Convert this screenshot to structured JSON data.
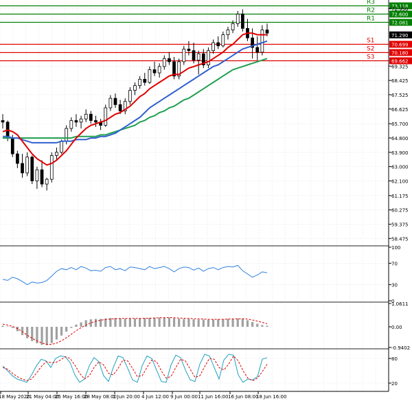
{
  "chart_data": {
    "type": "candlestick",
    "grid": true,
    "main": {
      "y_ticks": [
        58.475,
        59.375,
        60.275,
        61.175,
        62.1,
        63.0,
        63.9,
        64.8,
        65.7,
        66.625,
        67.525,
        68.425,
        69.325,
        72.95
      ],
      "y_range": [
        58.1,
        73.4
      ],
      "candles": [
        {
          "o": 65.9,
          "h": 66.3,
          "l": 65.4,
          "c": 65.8
        },
        {
          "o": 65.8,
          "h": 65.9,
          "l": 64.6,
          "c": 64.8
        },
        {
          "o": 64.8,
          "h": 65.0,
          "l": 63.6,
          "c": 63.8
        },
        {
          "o": 63.8,
          "h": 64.0,
          "l": 62.9,
          "c": 63.2
        },
        {
          "o": 63.2,
          "h": 63.8,
          "l": 62.3,
          "c": 62.6
        },
        {
          "o": 62.6,
          "h": 63.9,
          "l": 62.4,
          "c": 63.6
        },
        {
          "o": 63.6,
          "h": 63.7,
          "l": 61.9,
          "c": 62.1
        },
        {
          "o": 62.1,
          "h": 63.0,
          "l": 61.6,
          "c": 62.8
        },
        {
          "o": 62.8,
          "h": 63.4,
          "l": 61.7,
          "c": 61.9
        },
        {
          "o": 61.9,
          "h": 62.3,
          "l": 61.5,
          "c": 62.2
        },
        {
          "o": 62.2,
          "h": 63.9,
          "l": 62.0,
          "c": 63.7
        },
        {
          "o": 63.7,
          "h": 64.2,
          "l": 63.4,
          "c": 63.9
        },
        {
          "o": 63.9,
          "h": 64.7,
          "l": 63.8,
          "c": 64.6
        },
        {
          "o": 64.6,
          "h": 65.6,
          "l": 64.4,
          "c": 65.4
        },
        {
          "o": 65.4,
          "h": 66.1,
          "l": 65.2,
          "c": 65.9
        },
        {
          "o": 65.9,
          "h": 66.3,
          "l": 65.5,
          "c": 65.8
        },
        {
          "o": 65.8,
          "h": 66.2,
          "l": 65.4,
          "c": 66.0
        },
        {
          "o": 66.0,
          "h": 66.6,
          "l": 65.8,
          "c": 66.3
        },
        {
          "o": 66.3,
          "h": 66.5,
          "l": 65.7,
          "c": 65.9
        },
        {
          "o": 65.9,
          "h": 66.2,
          "l": 65.5,
          "c": 65.8
        },
        {
          "o": 65.8,
          "h": 66.0,
          "l": 65.3,
          "c": 65.6
        },
        {
          "o": 65.6,
          "h": 66.9,
          "l": 65.5,
          "c": 66.7
        },
        {
          "o": 66.7,
          "h": 67.5,
          "l": 66.5,
          "c": 67.3
        },
        {
          "o": 67.3,
          "h": 67.6,
          "l": 66.7,
          "c": 66.9
        },
        {
          "o": 66.9,
          "h": 67.2,
          "l": 66.3,
          "c": 66.5
        },
        {
          "o": 66.5,
          "h": 67.3,
          "l": 66.3,
          "c": 67.1
        },
        {
          "o": 67.1,
          "h": 68.0,
          "l": 66.9,
          "c": 67.8
        },
        {
          "o": 67.8,
          "h": 68.3,
          "l": 67.5,
          "c": 68.1
        },
        {
          "o": 68.1,
          "h": 68.7,
          "l": 67.9,
          "c": 68.5
        },
        {
          "o": 68.5,
          "h": 68.9,
          "l": 68.1,
          "c": 68.3
        },
        {
          "o": 68.3,
          "h": 69.3,
          "l": 68.2,
          "c": 69.1
        },
        {
          "o": 69.1,
          "h": 69.6,
          "l": 68.7,
          "c": 68.9
        },
        {
          "o": 68.9,
          "h": 69.5,
          "l": 68.6,
          "c": 69.3
        },
        {
          "o": 69.3,
          "h": 70.0,
          "l": 69.1,
          "c": 69.8
        },
        {
          "o": 69.8,
          "h": 70.2,
          "l": 69.4,
          "c": 69.6
        },
        {
          "o": 69.6,
          "h": 69.9,
          "l": 68.5,
          "c": 68.7
        },
        {
          "o": 68.7,
          "h": 69.8,
          "l": 68.5,
          "c": 69.6
        },
        {
          "o": 69.6,
          "h": 70.6,
          "l": 69.4,
          "c": 70.4
        },
        {
          "o": 70.4,
          "h": 70.9,
          "l": 70.0,
          "c": 70.3
        },
        {
          "o": 70.3,
          "h": 70.8,
          "l": 69.5,
          "c": 69.7
        },
        {
          "o": 69.7,
          "h": 70.3,
          "l": 68.8,
          "c": 70.1
        },
        {
          "o": 70.1,
          "h": 70.4,
          "l": 69.2,
          "c": 69.4
        },
        {
          "o": 69.4,
          "h": 70.5,
          "l": 69.2,
          "c": 70.3
        },
        {
          "o": 70.3,
          "h": 71.0,
          "l": 70.1,
          "c": 70.8
        },
        {
          "o": 70.8,
          "h": 71.2,
          "l": 70.4,
          "c": 70.6
        },
        {
          "o": 70.6,
          "h": 71.5,
          "l": 70.5,
          "c": 71.3
        },
        {
          "o": 71.3,
          "h": 71.8,
          "l": 71.0,
          "c": 71.6
        },
        {
          "o": 71.6,
          "h": 72.2,
          "l": 71.4,
          "c": 72.0
        },
        {
          "o": 72.0,
          "h": 72.8,
          "l": 71.8,
          "c": 72.6
        },
        {
          "o": 72.6,
          "h": 72.9,
          "l": 71.5,
          "c": 71.7
        },
        {
          "o": 71.7,
          "h": 72.3,
          "l": 70.9,
          "c": 71.1
        },
        {
          "o": 71.1,
          "h": 71.7,
          "l": 69.8,
          "c": 70.5
        },
        {
          "o": 70.5,
          "h": 71.2,
          "l": 69.7,
          "c": 70.2
        },
        {
          "o": 70.2,
          "h": 71.9,
          "l": 70.0,
          "c": 71.6
        },
        {
          "o": 71.6,
          "h": 72.0,
          "l": 71.2,
          "c": 71.4
        }
      ],
      "sma_red": [
        65.2,
        65.3,
        65.2,
        65.0,
        64.6,
        64.2,
        63.8,
        63.5,
        63.3,
        63.1,
        63.2,
        63.4,
        63.7,
        64.0,
        64.4,
        64.8,
        65.1,
        65.4,
        65.6,
        65.7,
        65.8,
        65.9,
        66.1,
        66.3,
        66.4,
        66.6,
        66.8,
        67.1,
        67.4,
        67.6,
        67.9,
        68.1,
        68.3,
        68.5,
        68.7,
        68.8,
        68.8,
        69.0,
        69.2,
        69.3,
        69.4,
        69.5,
        69.6,
        69.8,
        70.0,
        70.2,
        70.5,
        70.7,
        71.0,
        71.3,
        71.4,
        71.4,
        71.3,
        71.3,
        71.3
      ],
      "sma_blue": [
        64.9,
        64.9,
        64.8,
        64.8,
        64.7,
        64.6,
        64.5,
        64.5,
        64.5,
        64.5,
        64.5,
        64.5,
        64.6,
        64.6,
        64.6,
        64.7,
        64.7,
        64.7,
        64.8,
        64.8,
        64.9,
        64.9,
        65.0,
        65.1,
        65.3,
        65.5,
        65.7,
        65.9,
        66.1,
        66.4,
        66.7,
        66.9,
        67.1,
        67.3,
        67.5,
        67.7,
        67.9,
        68.1,
        68.3,
        68.5,
        68.7,
        68.9,
        69.1,
        69.3,
        69.4,
        69.6,
        69.8,
        70.0,
        70.2,
        70.4,
        70.5,
        70.6,
        70.7,
        70.8,
        70.9
      ],
      "sma_green": [
        64.8,
        64.8,
        64.8,
        64.8,
        64.8,
        64.8,
        64.8,
        64.8,
        64.8,
        64.8,
        64.8,
        64.8,
        64.8,
        64.8,
        64.8,
        64.9,
        64.9,
        64.9,
        64.9,
        64.9,
        65.0,
        65.0,
        65.1,
        65.2,
        65.3,
        65.4,
        65.5,
        65.6,
        65.8,
        65.9,
        66.1,
        66.2,
        66.4,
        66.5,
        66.7,
        66.8,
        67.0,
        67.2,
        67.3,
        67.5,
        67.7,
        67.9,
        68.1,
        68.3,
        68.5,
        68.7,
        68.9,
        69.1,
        69.2,
        69.3,
        69.4,
        69.5,
        69.6,
        69.7,
        69.8
      ],
      "levels": [
        {
          "name": "R3",
          "value": 73.118,
          "label": "73.118",
          "color": "#008000",
          "badge": "#008000"
        },
        {
          "name": "R2",
          "value": 72.6,
          "label": "72.600",
          "color": "#008000",
          "badge": "#008000"
        },
        {
          "name": "R1",
          "value": 72.081,
          "label": "72.081",
          "color": "#008000",
          "badge": "#008000"
        },
        {
          "name": "",
          "value": 71.29,
          "label": "71.290",
          "color": "none",
          "badge": "#000000"
        },
        {
          "name": "S1",
          "value": 70.699,
          "label": "70.699",
          "color": "#e00000",
          "badge": "#e00000"
        },
        {
          "name": "S2",
          "value": 70.18,
          "label": "70.180",
          "color": "#e00000",
          "badge": "#e00000"
        },
        {
          "name": "S3",
          "value": 69.662,
          "label": "69.662",
          "color": "#e00000",
          "badge": "#e00000"
        }
      ]
    },
    "rsi": {
      "y_ticks": [
        100,
        70,
        30,
        0
      ],
      "values": [
        40,
        38,
        44,
        41,
        36,
        30,
        35,
        33,
        34,
        38,
        46,
        55,
        60,
        58,
        62,
        58,
        64,
        61,
        56,
        57,
        55,
        62,
        64,
        58,
        60,
        56,
        63,
        62,
        60,
        58,
        64,
        60,
        62,
        64,
        60,
        54,
        60,
        63,
        62,
        57,
        61,
        55,
        60,
        62,
        58,
        62,
        64,
        63,
        66,
        56,
        50,
        44,
        48,
        54,
        52
      ]
    },
    "macd": {
      "y_ticks": [
        "1.0611",
        "0.00",
        "-0.9402"
      ],
      "hist": [
        0.05,
        0.02,
        -0.05,
        -0.2,
        -0.38,
        -0.52,
        -0.65,
        -0.75,
        -0.82,
        -0.84,
        -0.74,
        -0.58,
        -0.4,
        -0.22,
        -0.05,
        0.1,
        0.2,
        0.3,
        0.34,
        0.36,
        0.36,
        0.38,
        0.4,
        0.4,
        0.38,
        0.37,
        0.38,
        0.38,
        0.39,
        0.4,
        0.41,
        0.42,
        0.42,
        0.43,
        0.42,
        0.4,
        0.37,
        0.36,
        0.36,
        0.34,
        0.33,
        0.33,
        0.32,
        0.33,
        0.34,
        0.35,
        0.36,
        0.37,
        0.38,
        0.36,
        0.3,
        0.22,
        0.14,
        0.08,
        0.05
      ],
      "signal": [
        0.12,
        0.08,
        0.02,
        -0.08,
        -0.22,
        -0.38,
        -0.52,
        -0.64,
        -0.74,
        -0.8,
        -0.8,
        -0.74,
        -0.64,
        -0.5,
        -0.34,
        -0.18,
        -0.04,
        0.08,
        0.18,
        0.25,
        0.3,
        0.33,
        0.35,
        0.37,
        0.38,
        0.38,
        0.38,
        0.38,
        0.38,
        0.39,
        0.39,
        0.4,
        0.41,
        0.41,
        0.42,
        0.41,
        0.4,
        0.39,
        0.38,
        0.37,
        0.36,
        0.35,
        0.34,
        0.34,
        0.34,
        0.34,
        0.35,
        0.36,
        0.36,
        0.37,
        0.35,
        0.31,
        0.26,
        0.2,
        0.14
      ]
    },
    "stoch": {
      "y_ticks": [
        80,
        20
      ],
      "k": [
        62,
        50,
        38,
        30,
        26,
        22,
        40,
        62,
        78,
        74,
        58,
        80,
        86,
        84,
        70,
        40,
        22,
        30,
        62,
        82,
        72,
        38,
        24,
        58,
        86,
        82,
        56,
        28,
        22,
        62,
        86,
        80,
        52,
        24,
        22,
        64,
        88,
        82,
        52,
        28,
        24,
        66,
        90,
        86,
        58,
        30,
        76,
        90,
        88,
        40,
        22,
        30,
        28,
        36,
        78,
        82
      ],
      "d": [
        58,
        54,
        44,
        36,
        30,
        26,
        30,
        44,
        60,
        72,
        70,
        70,
        76,
        84,
        80,
        64,
        44,
        30,
        38,
        58,
        72,
        64,
        44,
        40,
        56,
        76,
        74,
        56,
        36,
        38,
        58,
        76,
        72,
        50,
        32,
        36,
        58,
        78,
        74,
        54,
        34,
        38,
        60,
        80,
        78,
        58,
        52,
        66,
        86,
        74,
        50,
        32,
        26,
        32,
        48,
        66
      ]
    },
    "x_ticks": [
      "18 May 2020",
      "21 May 04:00",
      "25 May 16:00",
      "28 May 08:00",
      "1 Jun 20:00",
      "4 Jun 12:00",
      "9 Jun 00:00",
      "11 Jun 16:00",
      "16 Jun 08:00",
      "18 Jun 16:00"
    ],
    "colors": {
      "bull": "#ffffff",
      "bear": "#000000",
      "candle_outline": "#000000",
      "sma_red": "#e00000",
      "sma_blue": "#3060d0",
      "sma_green": "#20a050",
      "rsi": "#3080e0",
      "macd_hist": "#a0a0a0",
      "macd_signal": "#e00000",
      "stoch_k": "#20a0c0",
      "stoch_d": "#e00000",
      "grid": "#d8d8d8",
      "separator": "#909090"
    }
  }
}
